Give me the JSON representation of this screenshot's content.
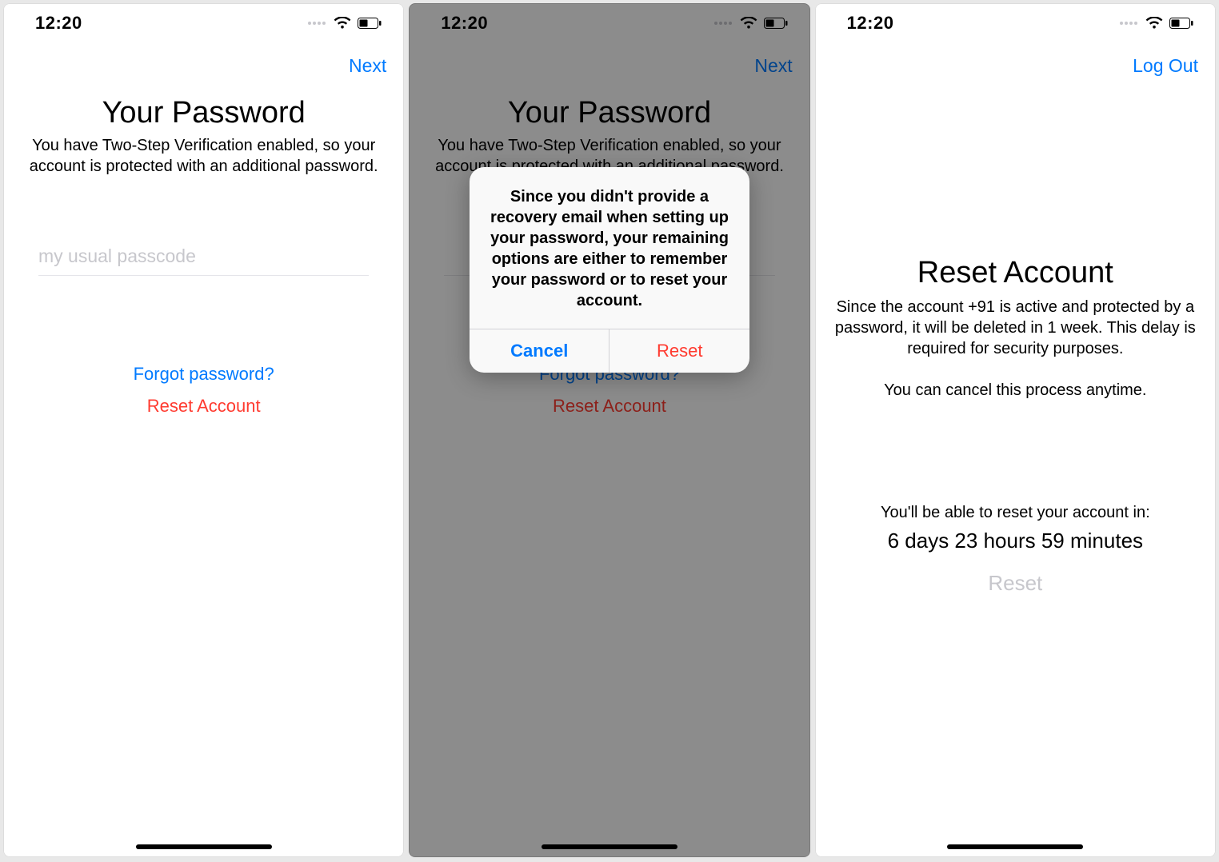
{
  "screen1": {
    "status": {
      "time": "12:20"
    },
    "nav": {
      "next": "Next"
    },
    "title": "Your Password",
    "subtitle": "You have Two-Step Verification enabled, so your account is protected with an additional password.",
    "input": {
      "placeholder": "my usual passcode",
      "value": ""
    },
    "forgot": "Forgot password?",
    "reset": "Reset Account"
  },
  "screen2": {
    "status": {
      "time": "12:20"
    },
    "nav": {
      "next": "Next"
    },
    "title": "Your Password",
    "subtitle": "You have Two-Step Verification enabled, so your account is protected with an additional password.",
    "forgot": "Forgot password?",
    "reset": "Reset Account",
    "alert": {
      "message": "Since you didn't provide a recovery email when setting up your password, your remaining options are either to remember your password or to reset your account.",
      "cancel": "Cancel",
      "reset": "Reset"
    }
  },
  "screen3": {
    "status": {
      "time": "12:20"
    },
    "nav": {
      "logout": "Log Out"
    },
    "title": "Reset Account",
    "body": "Since the account +91               is active and protected by a password, it will be deleted in 1 week. This delay is required for security purposes.",
    "cancel_note": "You can cancel this process anytime.",
    "countdown_label": "You'll be able to reset your account in:",
    "countdown_value": "6 days 23 hours 59 minutes",
    "reset_btn": "Reset"
  },
  "colors": {
    "blue": "#007aff",
    "red": "#ff3b30",
    "gray": "#c7c7cc"
  }
}
